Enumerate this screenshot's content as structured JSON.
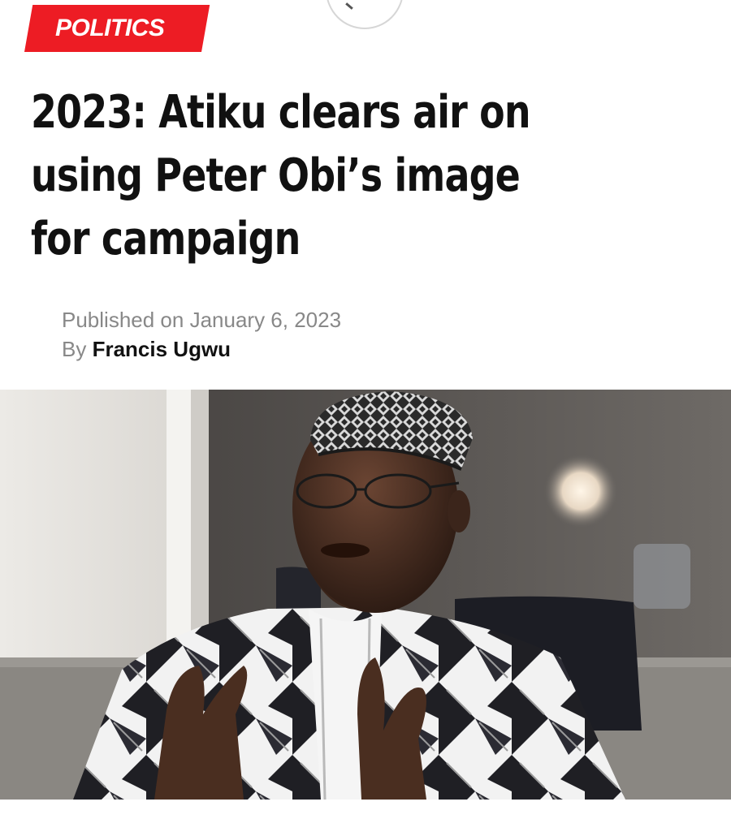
{
  "category": {
    "label": "POLITICS"
  },
  "article": {
    "headline": "2023: Atiku clears air on using Peter Obi’s image for campaign",
    "published_prefix": "Published on",
    "published_date": "January 6, 2023",
    "by_prefix": "By",
    "author": "Francis Ugwu"
  },
  "colors": {
    "category_bg": "#ed1c24",
    "headline": "#111111",
    "meta_muted": "#888888"
  },
  "icons": {
    "top_control": "partial-circle-button-icon"
  }
}
